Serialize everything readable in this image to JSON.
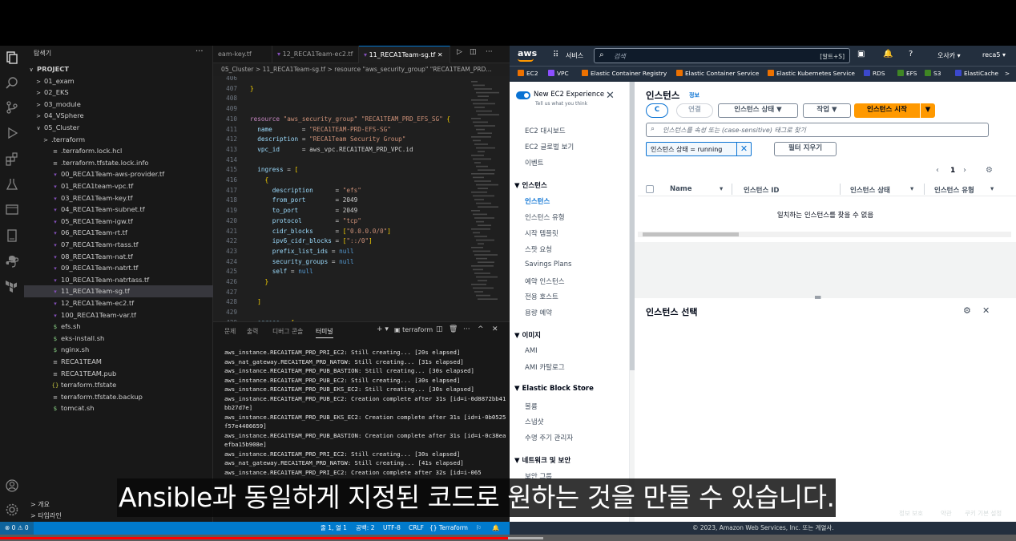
{
  "video": {
    "progress_fraction": 0.5
  },
  "vscode": {
    "sidebar_title": "탐색기",
    "sidebar_more": "···",
    "tree": [
      {
        "label": "PROJECT",
        "icon": "",
        "indent": 0,
        "chev": "∨",
        "bold": true
      },
      {
        "label": "01_exam",
        "icon": "",
        "indent": 1,
        "chev": ">"
      },
      {
        "label": "02_EKS",
        "icon": "",
        "indent": 1,
        "chev": ">"
      },
      {
        "label": "03_module",
        "icon": "",
        "indent": 1,
        "chev": ">"
      },
      {
        "label": "04_VSphere",
        "icon": "",
        "indent": 1,
        "chev": ">"
      },
      {
        "label": "05_Cluster",
        "icon": "",
        "indent": 1,
        "chev": "∨"
      },
      {
        "label": ".terraform",
        "icon": "",
        "indent": 2,
        "chev": ">"
      },
      {
        "label": ".terraform.lock.hcl",
        "icon": "≡",
        "indent": 2,
        "chev": ""
      },
      {
        "label": ".terraform.tfstate.lock.info",
        "icon": "≡",
        "indent": 2,
        "chev": ""
      },
      {
        "label": "00_RECA1Team-aws-provider.tf",
        "icon": "tf",
        "indent": 2,
        "chev": ""
      },
      {
        "label": "01_RECA1team-vpc.tf",
        "icon": "tf",
        "indent": 2,
        "chev": ""
      },
      {
        "label": "03_RECA1Team-key.tf",
        "icon": "tf",
        "indent": 2,
        "chev": ""
      },
      {
        "label": "04_RECA1Team-subnet.tf",
        "icon": "tf",
        "indent": 2,
        "chev": ""
      },
      {
        "label": "05_RECA1Team-igw.tf",
        "icon": "tf",
        "indent": 2,
        "chev": ""
      },
      {
        "label": "06_RECA1Team-rt.tf",
        "icon": "tf",
        "indent": 2,
        "chev": ""
      },
      {
        "label": "07_RECA1Team-rtass.tf",
        "icon": "tf",
        "indent": 2,
        "chev": ""
      },
      {
        "label": "08_RECA1Team-nat.tf",
        "icon": "tf",
        "indent": 2,
        "chev": ""
      },
      {
        "label": "09_RECA1Team-natrt.tf",
        "icon": "tf",
        "indent": 2,
        "chev": ""
      },
      {
        "label": "10_RECA1Team-natrtass.tf",
        "icon": "tf",
        "indent": 2,
        "chev": ""
      },
      {
        "label": "11_RECA1Team-sg.tf",
        "icon": "tf",
        "indent": 2,
        "chev": "",
        "selected": true
      },
      {
        "label": "12_RECA1Team-ec2.tf",
        "icon": "tf",
        "indent": 2,
        "chev": ""
      },
      {
        "label": "100_RECA1Team-var.tf",
        "icon": "tf",
        "indent": 2,
        "chev": ""
      },
      {
        "label": "efs.sh",
        "icon": "$",
        "indent": 2,
        "chev": ""
      },
      {
        "label": "eks-install.sh",
        "icon": "$",
        "indent": 2,
        "chev": ""
      },
      {
        "label": "nginx.sh",
        "icon": "$",
        "indent": 2,
        "chev": ""
      },
      {
        "label": "RECA1TEAM",
        "icon": "≡",
        "indent": 2,
        "chev": ""
      },
      {
        "label": "RECA1TEAM.pub",
        "icon": "≡",
        "indent": 2,
        "chev": ""
      },
      {
        "label": "terraform.tfstate",
        "icon": "{}",
        "indent": 2,
        "chev": ""
      },
      {
        "label": "terraform.tfstate.backup",
        "icon": "≡",
        "indent": 2,
        "chev": ""
      },
      {
        "label": "tomcat.sh",
        "icon": "$",
        "indent": 2,
        "chev": ""
      }
    ],
    "outline_label": "> 개요",
    "timeline_label": "> 타임라인",
    "tabs": [
      {
        "label": "eam-key.tf"
      },
      {
        "label": "12_RECA1Team-ec2.tf"
      },
      {
        "label": "11_RECA1Team-sg.tf  ✕",
        "active": true
      }
    ],
    "breadcrumb": "05_Cluster > 11_RECA1Team-sg.tf > resource \"aws_security_group\" \"RECA1TEAM_PRD...",
    "line_numbers": [
      "406",
      "407",
      "408",
      "409",
      "410",
      "411",
      "412",
      "413",
      "414",
      "415",
      "416",
      "417",
      "418",
      "419",
      "420",
      "421",
      "422",
      "423",
      "424",
      "425",
      "426",
      "427",
      "428",
      "429",
      "430"
    ],
    "code_lines": [
      "",
      "}",
      "",
      "",
      "resource \"aws_security_group\" \"RECA1TEAM_PRD_EFS_SG\" {",
      "  name        = \"RECA1TEAM-PRD-EFS-SG\"",
      "  description = \"RECA1Team Security Group\"",
      "  vpc_id      = aws_vpc.RECA1TEAM_PRD_VPC.id",
      "",
      "  ingress = [",
      "    {",
      "      description      = \"efs\"",
      "      from_port        = 2049",
      "      to_port          = 2049",
      "      protocol         = \"tcp\"",
      "      cidr_blocks      = [\"0.0.0.0/0\"]",
      "      ipv6_cidr_blocks = [\"::/0\"]",
      "      prefix_list_ids = null",
      "      security_groups = null",
      "      self = null",
      "    }",
      "",
      "  ]",
      "",
      "  egress = ["
    ],
    "panel_tabs": [
      "문제",
      "출력",
      "디버그 콘솔",
      "터미널"
    ],
    "panel_active": 3,
    "terminal_name": "terraform",
    "terminal_lines": [
      "aws_instance.RECA1TEAM_PRD_PRI_EC2: Still creating... [20s elapsed]",
      "aws_nat_gateway.RECA1TEAM_PRD_NATGW: Still creating... [31s elapsed]",
      "aws_instance.RECA1TEAM_PRD_PUB_BASTION: Still creating... [30s elapsed]",
      "aws_instance.RECA1TEAM_PRD_PUB_EC2: Still creating... [30s elapsed]",
      "aws_instance.RECA1TEAM_PRD_PUB_EKS_EC2: Still creating... [30s elapsed]",
      "aws_instance.RECA1TEAM_PRD_PUB_EC2: Creation complete after 31s [id=i-0d8872bb41bb27d7e]",
      "aws_instance.RECA1TEAM_PRD_PUB_EKS_EC2: Creation complete after 31s [id=i-0b0525f57e4406659]",
      "aws_instance.RECA1TEAM_PRD_PUB_BASTION: Creation complete after 31s [id=i-0c38eaefba15b908e]",
      "aws_instance.RECA1TEAM_PRD_PRI_EC2: Still creating... [30s elapsed]",
      "aws_nat_gateway.RECA1TEAM_PRD_NATGW: Still creating... [41s elapsed]",
      "aws_instance.RECA1TEAM_PRD_PRI_EC2: Creation complete after 32s [id=i-065"
    ],
    "status": {
      "problems": "⊗ 0 ⚠ 0",
      "position": "줄 1, 열 1",
      "spaces": "공백: 2",
      "encoding": "UTF-8",
      "eol": "CRLF",
      "language": "{} Terraform"
    }
  },
  "aws": {
    "logo": "aws",
    "services": "서비스",
    "search_placeholder": "검색",
    "search_shortcut": "[알트+S]",
    "region": "오사카 ▾",
    "user": "reca5 ▾",
    "favorites": [
      {
        "label": "EC2",
        "color": "#ed7100"
      },
      {
        "label": "VPC",
        "color": "#8c4fff"
      },
      {
        "label": "Elastic Container Registry",
        "color": "#ed7100"
      },
      {
        "label": "Elastic Container Service",
        "color": "#ed7100"
      },
      {
        "label": "Elastic Kubernetes Service",
        "color": "#ed7100"
      },
      {
        "label": "RDS",
        "color": "#3b48cc"
      },
      {
        "label": "EFS",
        "color": "#3f8624"
      },
      {
        "label": "S3",
        "color": "#3f8624"
      },
      {
        "label": "ElastiCache",
        "color": "#3b48cc"
      }
    ],
    "new_experience": "New EC2 Experience",
    "new_experience_sub": "Tell us what you think",
    "nav": [
      {
        "label": "EC2 대시보드",
        "type": "item"
      },
      {
        "label": "EC2 글로벌 보기",
        "type": "item"
      },
      {
        "label": "이벤트",
        "type": "item"
      },
      {
        "label": "▼ 인스턴스",
        "type": "head"
      },
      {
        "label": "인스턴스",
        "type": "item",
        "current": true
      },
      {
        "label": "인스턴스 유형",
        "type": "item"
      },
      {
        "label": "시작 템플릿",
        "type": "item"
      },
      {
        "label": "스팟 요청",
        "type": "item"
      },
      {
        "label": "Savings Plans",
        "type": "item"
      },
      {
        "label": "예약 인스턴스",
        "type": "item"
      },
      {
        "label": "전용 호스트",
        "type": "item"
      },
      {
        "label": "용량 예약",
        "type": "item"
      },
      {
        "label": "▼ 이미지",
        "type": "head"
      },
      {
        "label": "AMI",
        "type": "item"
      },
      {
        "label": "AMI 카탈로그",
        "type": "item"
      },
      {
        "label": "▼ Elastic Block Store",
        "type": "head"
      },
      {
        "label": "볼륨",
        "type": "item"
      },
      {
        "label": "스냅샷",
        "type": "item"
      },
      {
        "label": "수명 주기 관리자",
        "type": "item"
      },
      {
        "label": "▼ 네트워크 및 보안",
        "type": "head"
      },
      {
        "label": "보안 그룹",
        "type": "item"
      }
    ],
    "main": {
      "title": "인스턴스",
      "info": "정보",
      "refresh": "C",
      "connect": "연결",
      "state_btn": "인스턴스 상태 ▼",
      "action_btn": "작업 ▼",
      "launch_btn": "인스턴스 시작",
      "launch_caret": "▼",
      "search_placeholder": "인스턴스를 속성 또는 (case-sensitive) 태그로 찾기",
      "filter_chip": "인스턴스 상태 = running",
      "clear_filters": "필터 지우기",
      "page": "1",
      "columns": [
        "Name",
        "인스턴스 ID",
        "인스턴스 상태",
        "인스턴스 유형"
      ],
      "empty": "일치하는 인스턴스를 찾을 수 없음",
      "detail_title": "인스턴스 선택"
    },
    "footer": {
      "copyright": "© 2023, Amazon Web Services, Inc. 또는 계열사.",
      "privacy": "정보 보호",
      "terms": "약관",
      "cookies": "쿠키 기본 설정"
    }
  },
  "subtitle": "Ansible과 동일하게 지정된 코드로 원하는 것을 만들 수 있습니다."
}
